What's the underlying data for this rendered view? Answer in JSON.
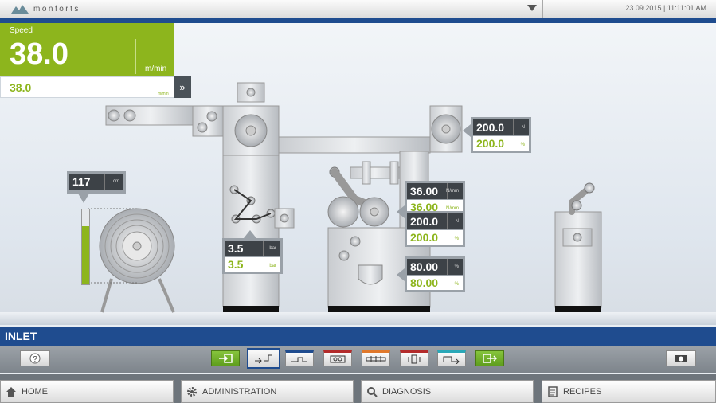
{
  "header": {
    "brand": "monforts",
    "datetime": "23.09.2015 | 11:11:01 AM"
  },
  "speed": {
    "label": "Speed",
    "value": "38.0",
    "unit": "m/min",
    "setpoint": "38.0",
    "setpoint_unit": "m/min",
    "expand_icon": "chevrons-right-icon"
  },
  "readouts": {
    "roll_diameter": {
      "actual": "117",
      "unit": "cm"
    },
    "pressure": {
      "actual": "3.5",
      "setpoint": "3.5",
      "unit": "bar"
    },
    "tension_top": {
      "actual": "200.0",
      "setpoint": "200.0",
      "unit_actual": "N",
      "unit_setpoint": "%"
    },
    "tension_nmm": {
      "actual": "36.00",
      "setpoint": "36.00",
      "unit": "N/mm"
    },
    "tension_mid": {
      "actual": "200.0",
      "setpoint": "200.0",
      "unit_actual": "N",
      "unit_setpoint": "%"
    },
    "dancer": {
      "actual": "80.00",
      "setpoint": "80.00",
      "unit": "%"
    }
  },
  "fill_level": 0.78,
  "section": {
    "title": "INLET"
  },
  "toolbar": {
    "help_icon": "question-icon",
    "screenshot_icon": "camera-icon",
    "steps": [
      {
        "name": "enter",
        "icon": "arrow-in-icon",
        "style": "green",
        "accent": "#5f9e1d"
      },
      {
        "name": "inlet",
        "icon": "inlet-icon",
        "style": "selected",
        "accent": "#1f4c8f"
      },
      {
        "name": "padder",
        "icon": "padder-icon",
        "style": "normal",
        "accent": "#1f4c8f"
      },
      {
        "name": "dryer",
        "icon": "dryer-icon",
        "style": "normal",
        "accent": "#b32b2b"
      },
      {
        "name": "stretcher",
        "icon": "stretch-icon",
        "style": "normal",
        "accent": "#e0782b"
      },
      {
        "name": "cooling",
        "icon": "cooling-icon",
        "style": "normal",
        "accent": "#b32b2b"
      },
      {
        "name": "outlet",
        "icon": "outlet-icon",
        "style": "normal",
        "accent": "#2aa8b8"
      },
      {
        "name": "exit",
        "icon": "arrow-out-icon",
        "style": "green",
        "accent": "#5f9e1d"
      }
    ]
  },
  "nav": {
    "home": "HOME",
    "administration": "ADMINISTRATION",
    "diagnosis": "DIAGNOSIS",
    "recipes": "RECIPES"
  }
}
